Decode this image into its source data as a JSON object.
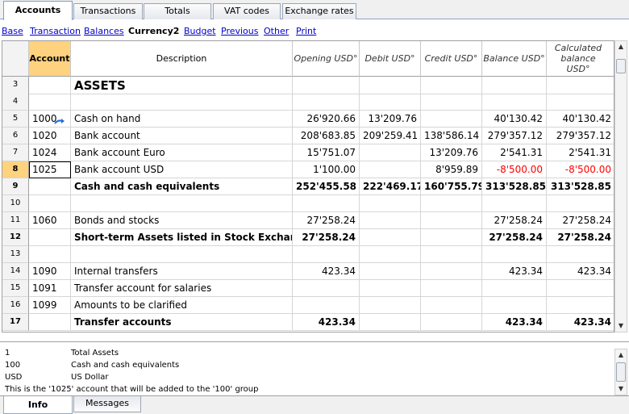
{
  "tabs": [
    {
      "label": "Accounts",
      "active": true
    },
    {
      "label": "Transactions",
      "active": false
    },
    {
      "label": "Totals",
      "active": false
    },
    {
      "label": "VAT codes",
      "active": false
    },
    {
      "label": "Exchange rates",
      "active": false
    }
  ],
  "views": [
    {
      "label": "Base",
      "current": false
    },
    {
      "label": "Transaction",
      "current": false
    },
    {
      "label": "Balances",
      "current": false
    },
    {
      "label": "Currency2",
      "current": true
    },
    {
      "label": "Budget",
      "current": false
    },
    {
      "label": "Previous",
      "current": false
    },
    {
      "label": "Other",
      "current": false
    },
    {
      "label": "Print",
      "current": false
    }
  ],
  "columns": {
    "account": "Account",
    "description": "Description",
    "opening": "Opening USD°",
    "debit": "Debit USD°",
    "credit": "Credit USD°",
    "balance": "Balance USD°",
    "calculated": "Calculated balance USD°"
  },
  "rows": [
    {
      "n": "3",
      "account": "",
      "description": "ASSETS",
      "opening": "",
      "debit": "",
      "credit": "",
      "balance": "",
      "calculated": "",
      "style": "heading"
    },
    {
      "n": "4",
      "account": "",
      "description": "",
      "opening": "",
      "debit": "",
      "credit": "",
      "balance": "",
      "calculated": "",
      "style": ""
    },
    {
      "n": "5",
      "account": "1000",
      "description": "Cash on hand",
      "opening": "26'920.66",
      "debit": "13'209.76",
      "credit": "",
      "balance": "40'130.42",
      "calculated": "40'130.42",
      "style": ""
    },
    {
      "n": "6",
      "account": "1020",
      "description": "Bank account",
      "opening": "208'683.85",
      "debit": "209'259.41",
      "credit": "138'586.14",
      "balance": "279'357.12",
      "calculated": "279'357.12",
      "style": ""
    },
    {
      "n": "7",
      "account": "1024",
      "description": "Bank account Euro",
      "opening": "15'751.07",
      "debit": "",
      "credit": "13'209.76",
      "balance": "2'541.31",
      "calculated": "2'541.31",
      "style": ""
    },
    {
      "n": "8",
      "account": "1025",
      "description": "Bank account USD",
      "opening": "1'100.00",
      "debit": "",
      "credit": "8'959.89",
      "balance": "-8'500.00",
      "calculated": "-8'500.00",
      "style": "selected"
    },
    {
      "n": "9",
      "account": "",
      "description": "Cash and cash equivalents",
      "opening": "252'455.58",
      "debit": "222'469.17",
      "credit": "160'755.79",
      "balance": "313'528.85",
      "calculated": "313'528.85",
      "style": "total"
    },
    {
      "n": "10",
      "account": "",
      "description": "",
      "opening": "",
      "debit": "",
      "credit": "",
      "balance": "",
      "calculated": "",
      "style": ""
    },
    {
      "n": "11",
      "account": "1060",
      "description": "Bonds and stocks",
      "opening": "27'258.24",
      "debit": "",
      "credit": "",
      "balance": "27'258.24",
      "calculated": "27'258.24",
      "style": ""
    },
    {
      "n": "12",
      "account": "",
      "description": "Short-term Assets listed in Stock Exchange",
      "opening": "27'258.24",
      "debit": "",
      "credit": "",
      "balance": "27'258.24",
      "calculated": "27'258.24",
      "style": "total"
    },
    {
      "n": "13",
      "account": "",
      "description": "",
      "opening": "",
      "debit": "",
      "credit": "",
      "balance": "",
      "calculated": "",
      "style": ""
    },
    {
      "n": "14",
      "account": "1090",
      "description": "Internal transfers",
      "opening": "423.34",
      "debit": "",
      "credit": "",
      "balance": "423.34",
      "calculated": "423.34",
      "style": ""
    },
    {
      "n": "15",
      "account": "1091",
      "description": "Transfer account for salaries",
      "opening": "",
      "debit": "",
      "credit": "",
      "balance": "",
      "calculated": "",
      "style": ""
    },
    {
      "n": "16",
      "account": "1099",
      "description": "Amounts to be clarified",
      "opening": "",
      "debit": "",
      "credit": "",
      "balance": "",
      "calculated": "",
      "style": ""
    },
    {
      "n": "17",
      "account": "",
      "description": "Transfer accounts",
      "opening": "423.34",
      "debit": "",
      "credit": "",
      "balance": "423.34",
      "calculated": "423.34",
      "style": "total"
    }
  ],
  "info": [
    {
      "code": "1",
      "text": "Total Assets"
    },
    {
      "code": "100",
      "text": "Cash and cash equivalents"
    },
    {
      "code": "USD",
      "text": "US Dollar"
    }
  ],
  "info_message": "This is the '1025' account that will be added to the '100' group",
  "bottom_tabs": [
    {
      "label": "Info",
      "active": true
    },
    {
      "label": "Messages",
      "active": false
    }
  ],
  "colors": {
    "accent_header": "#ffd27f",
    "negative": "#ff0000",
    "link": "#0000cc"
  }
}
